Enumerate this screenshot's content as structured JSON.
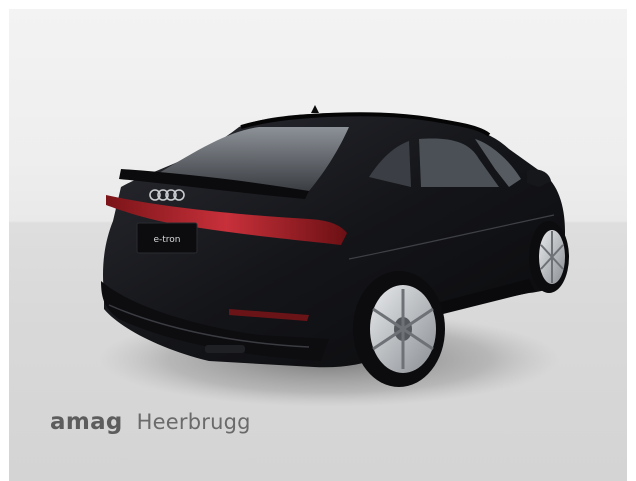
{
  "photo": {
    "subject_colors": {
      "body": "#111216",
      "taillight": "#b0232c",
      "background_top": "#f1f1f1",
      "background_floor": "#d6d6d6"
    },
    "badge_text": "e-tron"
  },
  "dealer": {
    "brand": "amag",
    "location": "Heerbrugg"
  }
}
